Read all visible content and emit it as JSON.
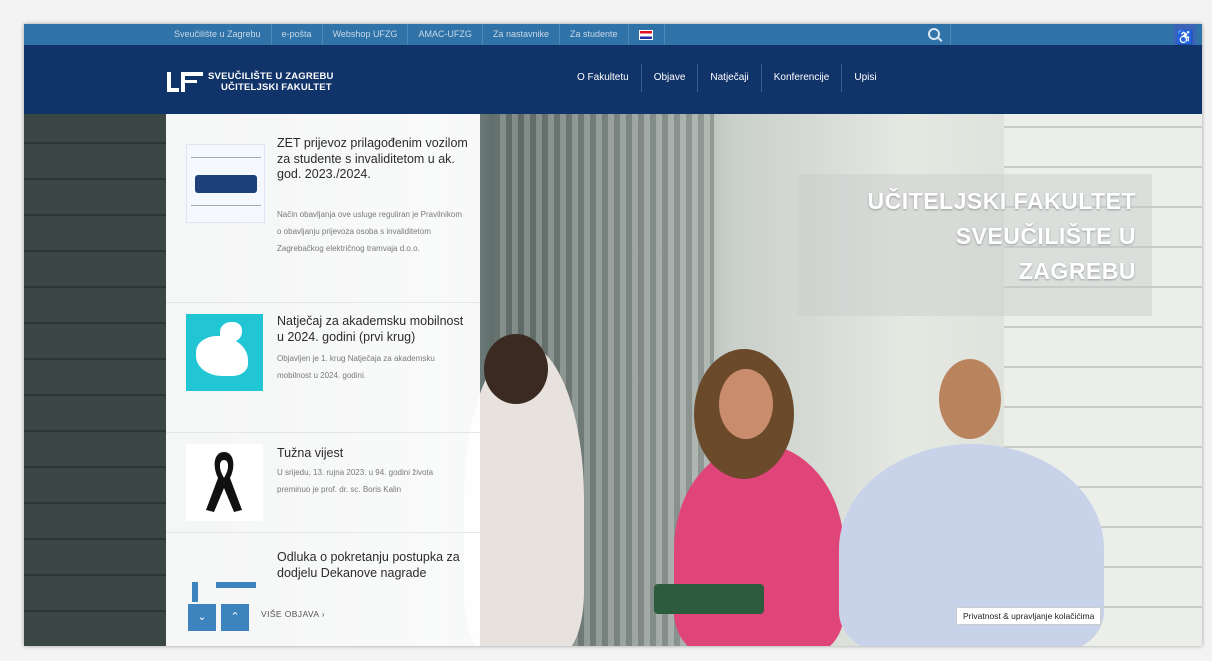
{
  "topbar": {
    "links": [
      "Sveučilište u Zagrebu",
      "e-pošta",
      "Webshop UFZG",
      "AMAC-UFZG",
      "Za nastavnike",
      "Za studente"
    ],
    "search_icon": "search-icon",
    "accessibility_icon": "accessibility-icon"
  },
  "header": {
    "logo_line1": "SVEUČILIŠTE U ZAGREBU",
    "logo_line2": "UČITELJSKI FAKULTET",
    "nav": [
      "O Fakultetu",
      "Objave",
      "Natječaji",
      "Konferencije",
      "Upisi"
    ]
  },
  "hero": {
    "title_line1": "UČITELJSKI FAKULTET",
    "title_line2": "SVEUČILIŠTE U",
    "title_line3": "ZAGREBU"
  },
  "news": {
    "items": [
      {
        "title": "ZET prijevoz prilagođenim vozilom za studente s invaliditetom u ak. god. 2023./2024.",
        "desc": "Način obavljanja ove usluge reguliran je Pravilnikom o obavljanju prijevoza osoba s invaliditetom Zagrebačkog električnog tramvaja d.o.o."
      },
      {
        "title": "Natječaj za akademsku mobilnost u 2024. godini (prvi krug)",
        "desc": "Objavljen je 1. krug Natječaja za akademsku mobilnost u 2024. godini."
      },
      {
        "title": "Tužna vijest",
        "desc": "U srijedu, 13. rujna 2023. u 94. godini života preminuo je prof. dr. sc. Boris Kalin"
      },
      {
        "title": "Odluka o pokretanju postupka za dodjelu Dekanove nagrade",
        "desc": ""
      }
    ],
    "more_label": "VIŠE OBJAVA  ›",
    "down_symbol": "⌄",
    "up_symbol": "⌃"
  },
  "cookie_label": "Privatnost & upravljanje kolačićima"
}
